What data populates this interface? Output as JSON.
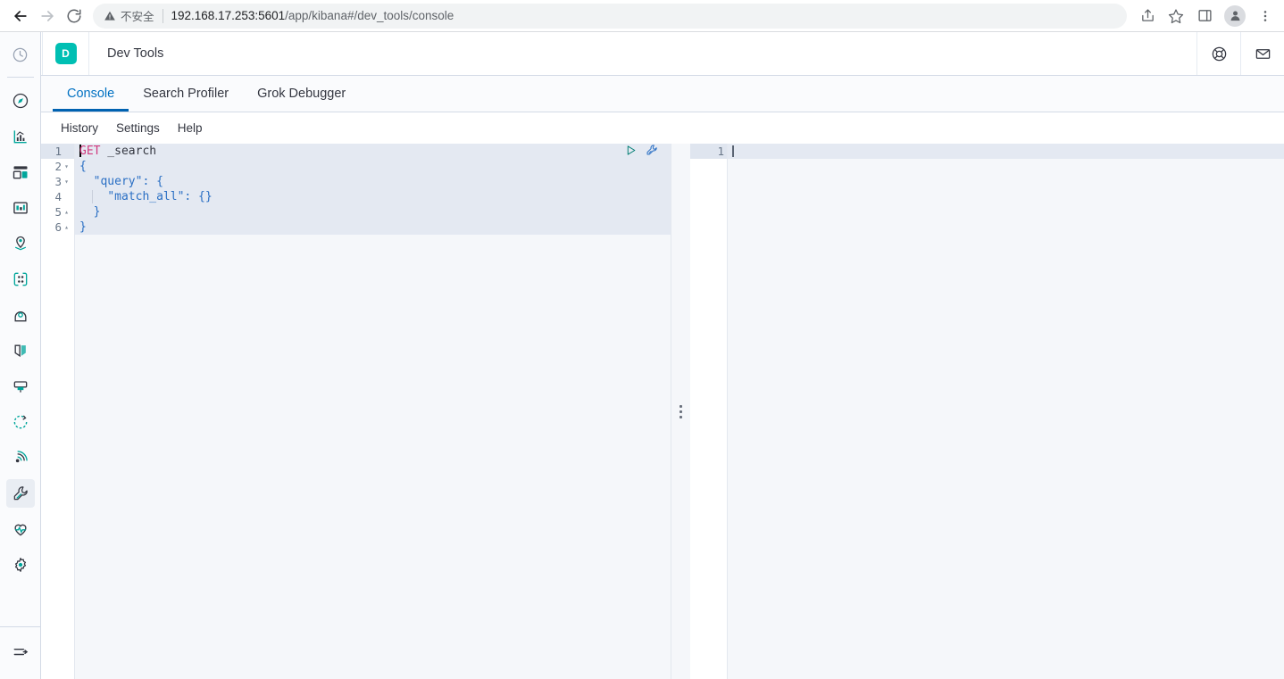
{
  "browser": {
    "back_icon": "arrow-left-icon",
    "forward_icon": "arrow-right-icon",
    "reload_icon": "reload-icon",
    "security_icon": "warning-triangle-icon",
    "security_label": "不安全",
    "url_host": "192.168.17.253:5601",
    "url_path": "/app/kibana#/dev_tools/console",
    "share_icon": "share-icon",
    "bookmark_icon": "star-icon",
    "sidepanel_icon": "side-panel-icon",
    "profile_icon": "profile-avatar-icon",
    "menu_icon": "three-dot-menu-icon"
  },
  "nav": {
    "logo_name": "kibana-logo",
    "recent_icon": "clock-icon",
    "items": [
      {
        "icon": "compass-icon",
        "name": "discover",
        "active": false
      },
      {
        "icon": "bar-chart-icon",
        "name": "visualize",
        "active": false
      },
      {
        "icon": "dashboard-icon",
        "name": "dashboard",
        "active": false
      },
      {
        "icon": "canvas-icon",
        "name": "canvas",
        "active": false
      },
      {
        "icon": "map-pin-icon",
        "name": "maps",
        "active": false
      },
      {
        "icon": "machine-learning-icon",
        "name": "machine-learning",
        "active": false
      },
      {
        "icon": "infrastructure-icon",
        "name": "infrastructure",
        "active": false
      },
      {
        "icon": "logs-icon",
        "name": "logs",
        "active": false
      },
      {
        "icon": "apm-icon",
        "name": "apm",
        "active": false
      },
      {
        "icon": "uptime-icon",
        "name": "uptime",
        "active": false
      },
      {
        "icon": "siem-icon",
        "name": "siem",
        "active": false
      },
      {
        "icon": "wrench-icon",
        "name": "dev-tools",
        "active": true
      },
      {
        "icon": "heartbeat-icon",
        "name": "monitoring",
        "active": false
      },
      {
        "icon": "gear-icon",
        "name": "management",
        "active": false
      }
    ],
    "collapse_icon": "collapse-nav-icon"
  },
  "header": {
    "app_badge": "D",
    "title": "Dev Tools",
    "help_icon": "help-lifebuoy-icon",
    "news_icon": "envelope-icon"
  },
  "tabs": [
    {
      "label": "Console",
      "active": true
    },
    {
      "label": "Search Profiler",
      "active": false
    },
    {
      "label": "Grok Debugger",
      "active": false
    }
  ],
  "submenu": [
    {
      "label": "History"
    },
    {
      "label": "Settings"
    },
    {
      "label": "Help"
    }
  ],
  "request_editor": {
    "play_icon": "play-request-icon",
    "wrench_icon": "console-tools-icon",
    "lines": [
      {
        "n": "1",
        "fold": "",
        "highlight": true,
        "current": true,
        "caret": true,
        "indent": false,
        "parts": [
          {
            "t": "GET",
            "c": "kw"
          },
          {
            "t": " _search",
            "c": "path"
          }
        ]
      },
      {
        "n": "2",
        "fold": "▾",
        "highlight": true,
        "current": false,
        "caret": false,
        "indent": false,
        "parts": [
          {
            "t": "{",
            "c": "punct"
          }
        ]
      },
      {
        "n": "3",
        "fold": "▾",
        "highlight": true,
        "current": false,
        "caret": false,
        "indent": false,
        "parts": [
          {
            "t": "  ",
            "c": "path"
          },
          {
            "t": "\"query\"",
            "c": "key"
          },
          {
            "t": ": {",
            "c": "punct"
          }
        ]
      },
      {
        "n": "4",
        "fold": "",
        "highlight": true,
        "current": false,
        "caret": false,
        "indent": true,
        "parts": [
          {
            "t": "    ",
            "c": "path"
          },
          {
            "t": "\"match_all\"",
            "c": "key"
          },
          {
            "t": ": {}",
            "c": "punct"
          }
        ]
      },
      {
        "n": "5",
        "fold": "▴",
        "highlight": true,
        "current": false,
        "caret": false,
        "indent": false,
        "parts": [
          {
            "t": "  }",
            "c": "punct"
          }
        ]
      },
      {
        "n": "6",
        "fold": "▴",
        "highlight": true,
        "current": false,
        "caret": false,
        "indent": false,
        "parts": [
          {
            "t": "}",
            "c": "punct"
          }
        ]
      }
    ]
  },
  "response_editor": {
    "lines": [
      {
        "n": "1",
        "current": true,
        "caret": true,
        "text": ""
      }
    ]
  },
  "splitter": {
    "name": "pane-resize-handle"
  },
  "colors": {
    "accent_blue": "#0062b1",
    "tab_active_text": "#0071c2",
    "badge_teal": "#00bfb3",
    "logo_pink": "#f04e98",
    "logo_dark": "#343741",
    "keyword_pink": "#d13a7e",
    "json_key_blue": "#2a6fc4",
    "play_green": "#017d73",
    "highlight_band": "#e4e9f2",
    "editor_bg": "#f5f7fa"
  }
}
